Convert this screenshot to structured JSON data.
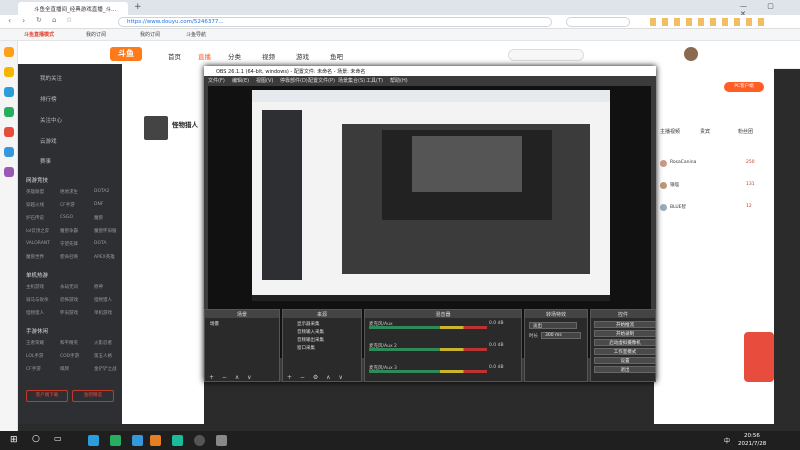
{
  "browser": {
    "tabs": [
      {
        "label": "斗鱼全直播间_经典游戏直播_斗..."
      },
      {
        "label": "我的订阅"
      }
    ],
    "url": "https://www.douyu.com/5246377...",
    "bookmarks": [
      "斗鱼直播模式",
      "我的订阅",
      "我的订阅",
      "斗鱼导航"
    ]
  },
  "site": {
    "logo": "斗鱼",
    "nav": [
      "首页",
      "直播",
      "分类",
      "视频",
      "游戏",
      "鱼吧"
    ],
    "room_name": "怪物猎人",
    "left_menu": [
      "我的关注",
      "排行榜",
      "关注中心",
      "云游戏",
      "赛事"
    ],
    "sections": [
      {
        "title": "网游竞技",
        "games": [
          "英雄联盟",
          "绝地求生",
          "DOTA2",
          "穿越火线",
          "CF手游",
          "DNF",
          "炉石传说",
          "CSGO",
          "魔兽",
          "lol云顶之弈",
          "魔兽争霸",
          "魔兽怀旧服",
          "VALORANT",
          "守望先锋",
          "DOTA",
          "魔兽世界",
          "使命召唤",
          "APEX英雄"
        ]
      },
      {
        "title": "单机热游",
        "games": [
          "主机游戏",
          "永劫无间",
          "原神",
          "骑马与砍杀",
          "恐怖游戏",
          "怪物猎人",
          "怪物猎人",
          "怀旧游戏",
          "单机游戏"
        ]
      },
      {
        "title": "手游休闲",
        "games": [
          "王者荣耀",
          "和平精英",
          "火影忍者",
          "LOL手游",
          "COD手游",
          "第五人格",
          "CF手游",
          "棋牌",
          "金铲铲之战"
        ]
      }
    ],
    "sidebar_buttons": [
      "客户端下载",
      "鱼吧精选"
    ]
  },
  "obs": {
    "title": "OBS 26.1.1 (64-bit, windows) - 配置文件: 未命名 - 场景: 未命名",
    "menu": [
      "文件(F)",
      "编辑(E)",
      "视图(V)",
      "停靠部件(D)",
      "配置文件(P)",
      "场景集合(S)",
      "工具(T)",
      "帮助(H)"
    ],
    "docks": {
      "scenes": {
        "title": "场景",
        "items": [
          "场景"
        ]
      },
      "sources": {
        "title": "来源",
        "items": [
          "显示器采集",
          "音频输入采集",
          "音频输出采集",
          "窗口采集"
        ]
      },
      "mixer": {
        "title": "混音器",
        "rows": [
          {
            "label": "麦克风/Aux",
            "db": "0.0 dB"
          },
          {
            "label": "麦克风/Aux 2",
            "db": "0.0 dB"
          },
          {
            "label": "麦克风/Aux 3",
            "db": "0.0 dB"
          }
        ]
      },
      "transitions": {
        "title": "转场特效",
        "type": "淡出",
        "duration_label": "时长",
        "duration": "300 ms"
      },
      "controls": {
        "title": "控件",
        "buttons": [
          "开始推流",
          "开始录制",
          "启动虚拟摄像机",
          "工作室模式",
          "设置",
          "退出"
        ]
      }
    },
    "no_source": "未选择源"
  },
  "right_panel": {
    "tabs": [
      "主播视频",
      "贵宾",
      "粉丝团"
    ],
    "rank": [
      {
        "name": "RosaCanina",
        "score": "250"
      },
      {
        "name": "银喵",
        "score": "131"
      },
      {
        "name": "BLUE智",
        "score": "12"
      }
    ],
    "pc_button": "PC客户端"
  },
  "taskbar": {
    "time": "20:56",
    "date": "2021/7/28",
    "lang": "中"
  }
}
